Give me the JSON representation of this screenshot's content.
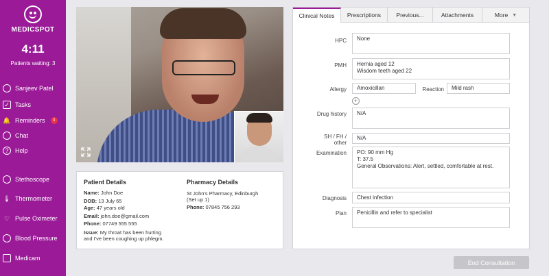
{
  "app": {
    "brand": "MEDICSPOT",
    "clock": "4:11",
    "patients_waiting": "Patients waiting: 3",
    "accent_color": "#9a1a97"
  },
  "sidebar": {
    "items": [
      {
        "label": "Sanjeev Patel",
        "icon": "user-icon"
      },
      {
        "label": "Tasks",
        "icon": "checklist-icon"
      },
      {
        "label": "Reminders",
        "icon": "bell-icon",
        "badge": "3"
      },
      {
        "label": "Chat",
        "icon": "chat-bubble-icon"
      },
      {
        "label": "Help",
        "icon": "help-icon"
      },
      {
        "label": "Stethoscope",
        "icon": "stethoscope-icon"
      },
      {
        "label": "Thermometer",
        "icon": "thermometer-icon"
      },
      {
        "label": "Pulse Oximeter",
        "icon": "pulse-oximeter-icon"
      },
      {
        "label": "Blood Pressure",
        "icon": "blood-pressure-icon"
      },
      {
        "label": "Medicam",
        "icon": "camera-icon"
      }
    ]
  },
  "patient": {
    "heading": "Patient Details",
    "name_label": "Name:",
    "name": "John Doe",
    "dob_label": "DOB:",
    "dob": "13 July 65",
    "age_label": "Age:",
    "age": "47 years old",
    "email_label": "Email:",
    "email": "john.doe@gmail.com",
    "phone_label": "Phone:",
    "phone": "07749 555 555",
    "issue_label": "Issue:",
    "issue_line1": "My throat has been hurting",
    "issue_line2": "and I've been coughing up phlegm."
  },
  "pharmacy": {
    "heading": "Pharmacy Details",
    "name_line1": "St John's Pharmacy, Edinburgh",
    "name_line2": "(Set up 1)",
    "phone_label": "Phone:",
    "phone": "07845 756 293"
  },
  "tabs": [
    {
      "label": "Clinical Notes",
      "active": true
    },
    {
      "label": "Prescriptions"
    },
    {
      "label": "Previous..."
    },
    {
      "label": "Attachments"
    },
    {
      "label": "More"
    }
  ],
  "notes": {
    "hpc_label": "HPC",
    "hpc": "None",
    "pmh_label": "PMH",
    "pmh_line1": "Hernia aged 12",
    "pmh_line2": "Wisdom teeth aged 22",
    "allergy_label": "Allergy",
    "allergy": "Amoxicillan",
    "reaction_label": "Reaction",
    "reaction": "Mild rash",
    "drug_history_label": "Drug history",
    "drug_history": "N/A",
    "sh_label_line1": "SH / FH /",
    "sh_label_line2": "other",
    "sh": "N/A",
    "exam_label": "Examination",
    "exam_line1": "PO: 90 mm Hg",
    "exam_line2": "T: 37.5",
    "exam_line3": "General Observations: Alert, settled, comfortable at rest.",
    "diagnosis_label": "Diagnosis",
    "diagnosis": "Chest infection",
    "plan_label": "Plan",
    "plan": "Penicillin and refer to specialist"
  },
  "actions": {
    "end_consultation": "End Consultation"
  }
}
